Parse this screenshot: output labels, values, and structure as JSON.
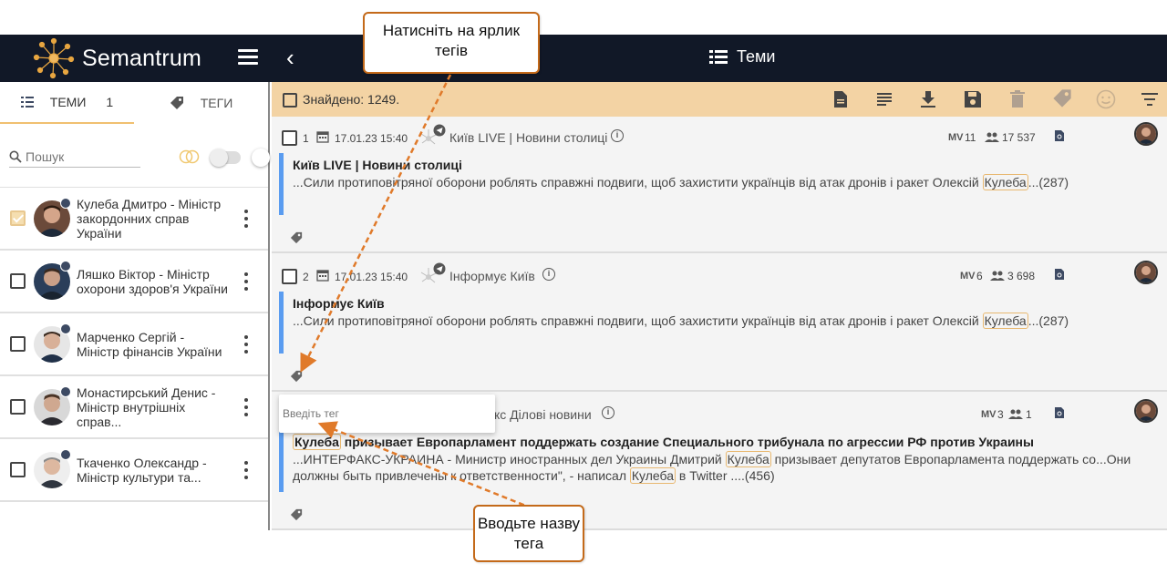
{
  "header": {
    "logo_text": "Semantrum",
    "page_title": "Теми"
  },
  "sidebar": {
    "tabs": [
      {
        "label": "ТЕМИ",
        "count": "1"
      },
      {
        "label": "ТЕГИ"
      }
    ],
    "search_placeholder": "Пошук",
    "persons": [
      {
        "name": "Кулеба Дмитро - Міністр закордонних справ України",
        "checked": true
      },
      {
        "name": "Ляшко Віктор - Міністр охорони здоров'я України",
        "checked": false
      },
      {
        "name": "Марченко Сергій - Міністр фінансів України",
        "checked": false
      },
      {
        "name": "Монастирський Денис - Міністр внутрішніх справ...",
        "checked": false
      },
      {
        "name": "Ткаченко Олександр - Міністр культури та...",
        "checked": false
      }
    ]
  },
  "toolbar": {
    "found_text": "Знайдено: 1249."
  },
  "items": [
    {
      "num": "1",
      "date": "17.01.23 15:40",
      "source": "Київ LIVE | Новини столиці",
      "mv_label": "MV",
      "mv": "11",
      "audience": "17 537",
      "headline": "Київ LIVE | Новини столиці",
      "snippet_pre": "...Сили протиповітряної оборони роблять справжні подвиги, щоб захистити українців від атак дронів і ракет Олексій ",
      "snippet_hl": "Кулеба",
      "snippet_post": "...(287)"
    },
    {
      "num": "2",
      "date": "17.01.23 15:40",
      "source": "Інформує Київ",
      "mv_label": "MV",
      "mv": "6",
      "audience": "3 698",
      "headline": "Інформує Київ",
      "snippet_pre": "...Сили протиповітряної оборони роблять справжні подвиги, щоб захистити українців від атак дронів і ракет Олексій ",
      "snippet_hl": "Кулеба",
      "snippet_post": "...(287)"
    },
    {
      "source": "кс Ділові новини",
      "mv_label": "MV",
      "mv": "3",
      "audience": "1",
      "headline_hl": "Кулеба",
      "headline_rest": " призывает Европарламент поддержать создание Специального трибунала по агрессии РФ против Украины",
      "snippet_a": "...ИНТЕРФАКС-УКРАИНА - Министр иностранных дел Украины Дмитрий ",
      "snippet_hl1": "Кулеба",
      "snippet_b": " призывает депутатов Европарламента поддержать со...Они должны быть привлечены к ответственности\", - написал ",
      "snippet_hl2": "Кулеба",
      "snippet_c": " в Twitter ....(456)"
    }
  ],
  "tag_input": {
    "placeholder": "Введіть тег"
  },
  "callouts": {
    "top": "Натисніть на ярлик тегів",
    "bottom": "Вводьте назву тега"
  },
  "colors": {
    "topbar": "#111827",
    "toolbar": "#f3d3a4",
    "accent_bar": "#5a9cf0",
    "callout_border": "#c46a1a"
  },
  "icons": {
    "menu": "hamburger-icon",
    "back": "chevron-left-icon",
    "list": "list-icon",
    "tag": "tag-icon",
    "search": "search-icon",
    "calendar": "calendar-icon",
    "info": "info-icon",
    "people": "people-icon",
    "telegram": "telegram-icon"
  }
}
